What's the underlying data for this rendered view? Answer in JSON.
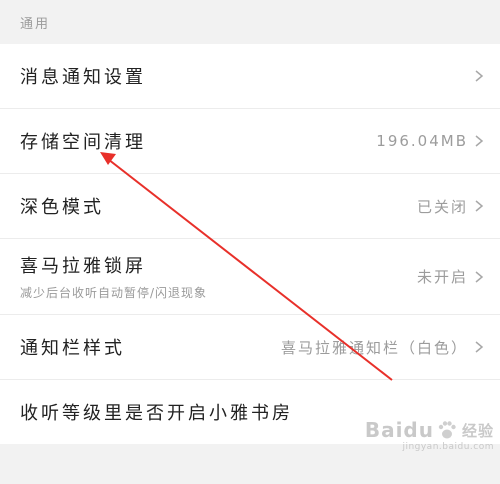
{
  "section": {
    "title": "通用"
  },
  "rows": [
    {
      "title": "消息通知设置",
      "value": ""
    },
    {
      "title": "存储空间清理",
      "value": "196.04MB"
    },
    {
      "title": "深色模式",
      "value": "已关闭"
    },
    {
      "title": "喜马拉雅锁屏",
      "subtitle": "减少后台收听自动暂停/闪退现象",
      "value": "未开启"
    },
    {
      "title": "通知栏样式",
      "value": "喜马拉雅通知栏（白色）"
    },
    {
      "title": "收听等级里是否开启小雅书房",
      "value": ""
    }
  ],
  "icons": {
    "chevron": "chevron-right-icon",
    "paw": "baidu-paw-icon"
  },
  "annotation": {
    "arrow_color": "#e8302a"
  },
  "watermark": {
    "brand": "Baidu",
    "text": "经验",
    "url": "jingyan.baidu.com"
  }
}
